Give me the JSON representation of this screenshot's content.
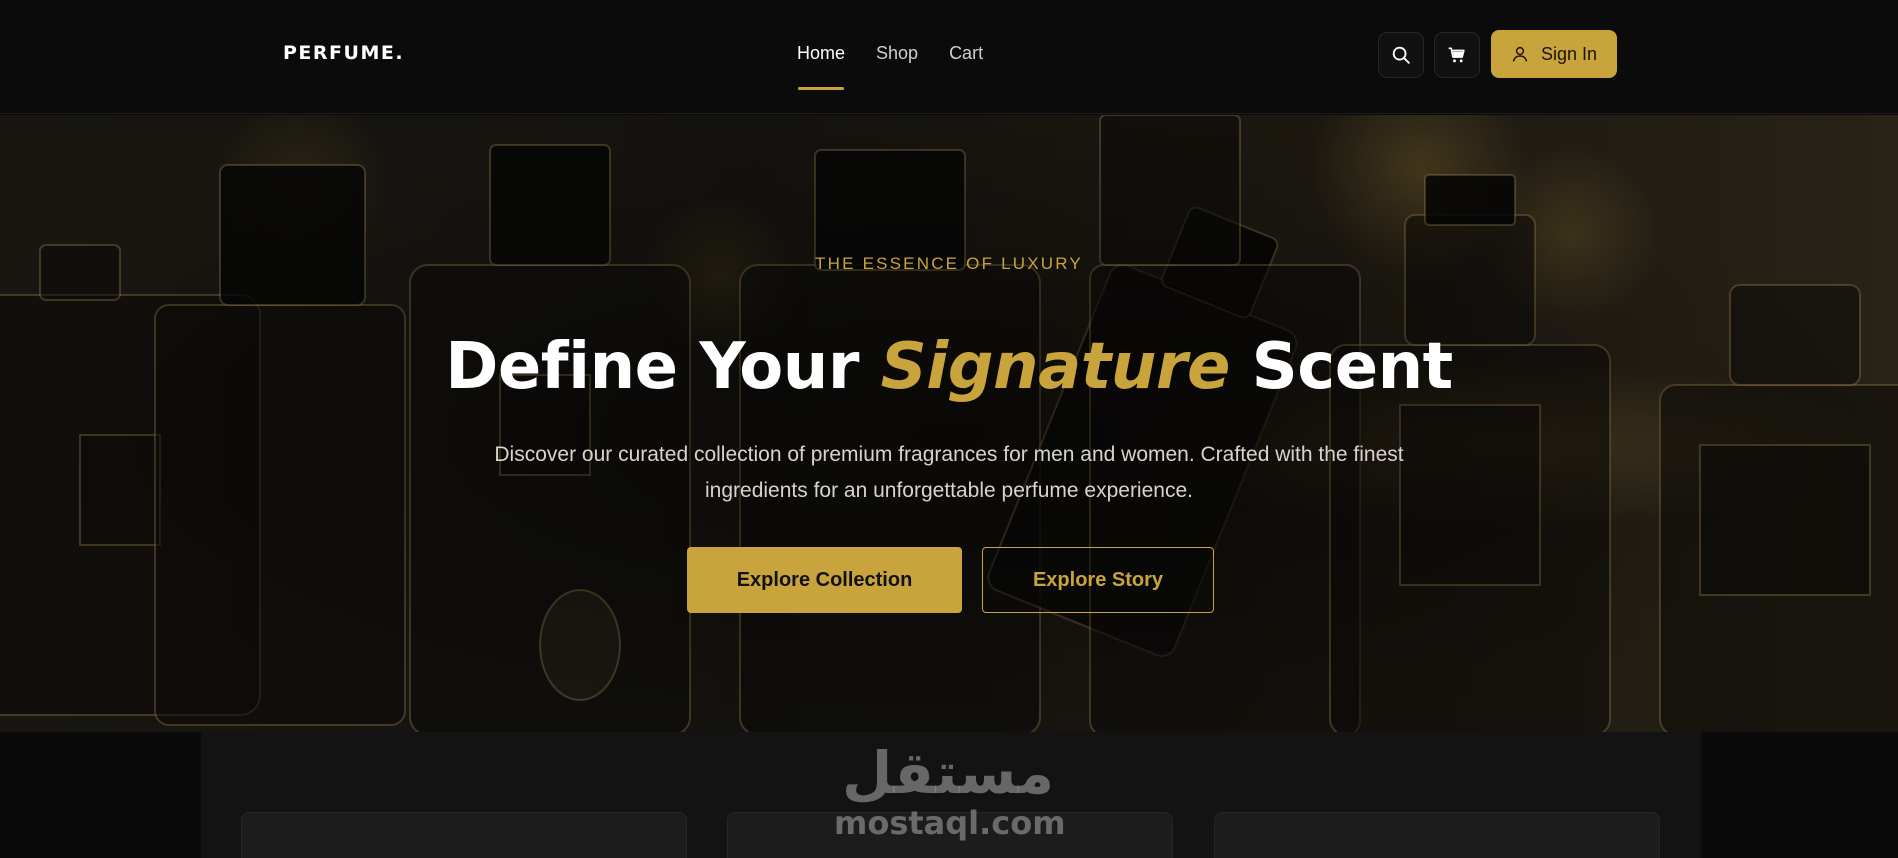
{
  "nav": {
    "logo": "PERFUME.",
    "links": [
      {
        "label": "Home",
        "active": true
      },
      {
        "label": "Shop",
        "active": false
      },
      {
        "label": "Cart",
        "active": false
      }
    ],
    "search_icon": "search-icon",
    "cart_icon": "cart-icon",
    "signin_label": "Sign In",
    "signin_icon": "user-icon"
  },
  "hero": {
    "eyebrow": "THE ESSENCE OF LUXURY",
    "headline_pre": "Define Your ",
    "headline_accent": "Signature",
    "headline_post": " Scent",
    "subtitle": "Discover our curated collection of premium fragrances for men and women. Crafted with the finest ingredients for an unforgettable perfume experience.",
    "primary_button": "Explore Collection",
    "secondary_button": "Explore Story"
  },
  "watermark": {
    "arabic": "مستقل",
    "latin": "mostaql.com"
  },
  "colors": {
    "accent": "#c9a43d",
    "background": "#0a0a0a",
    "text": "#ffffff"
  }
}
